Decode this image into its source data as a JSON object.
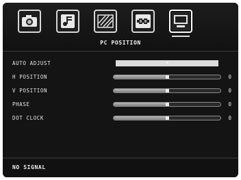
{
  "menu": {
    "tabs": [
      {
        "name": "picture",
        "icon": "camera-icon"
      },
      {
        "name": "sound",
        "icon": "music-note-icon"
      },
      {
        "name": "settings",
        "icon": "hatched-square-icon"
      },
      {
        "name": "source",
        "icon": "cable-plug-icon"
      },
      {
        "name": "pc",
        "icon": "monitor-icon",
        "active": true
      }
    ],
    "title": "PC POSITION"
  },
  "settings": {
    "auto_adjust": {
      "label": "AUTO ADJUST",
      "arrow": "➔"
    },
    "h_position": {
      "label": "H POSITION",
      "value": "0",
      "level": 0.5
    },
    "v_position": {
      "label": "V POSITION",
      "value": "0",
      "level": 0.5
    },
    "phase": {
      "label": "PHASE",
      "value": "0",
      "level": 0.5
    },
    "dot_clock": {
      "label": "DOT CLOCK",
      "value": "0",
      "level": 0.5
    }
  },
  "status": {
    "text": "NO SIGNAL"
  },
  "colors": {
    "background": "#141414",
    "text": "#e6e6e6",
    "highlight": "#dcdcdc"
  }
}
